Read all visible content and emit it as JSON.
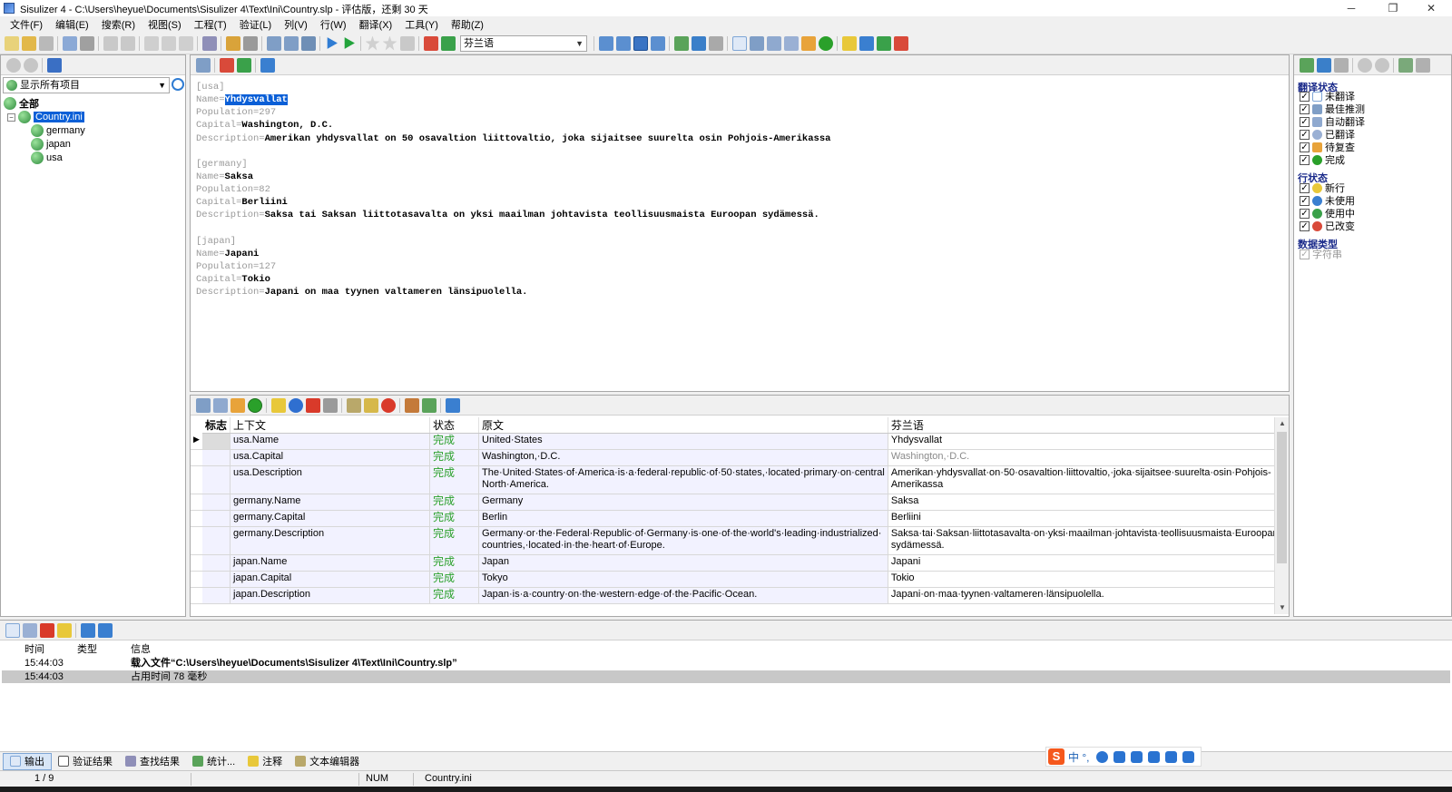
{
  "window": {
    "title": "Sisulizer 4 - C:\\Users\\heyue\\Documents\\Sisulizer 4\\Text\\Ini\\Country.slp - 评估版，还剩 30 天",
    "minimize": "─",
    "maximize": "❐",
    "close": "✕"
  },
  "menu": [
    "文件(F)",
    "编辑(E)",
    "搜索(R)",
    "视图(S)",
    "工程(T)",
    "验证(L)",
    "列(V)",
    "行(W)",
    "翻译(X)",
    "工具(Y)",
    "帮助(Z)"
  ],
  "toolbar": {
    "language_select": "芬兰语"
  },
  "left_panel": {
    "filter": "显示所有项目",
    "tree": {
      "root": "全部",
      "file": "Country.ini",
      "children": [
        "germany",
        "japan",
        "usa"
      ]
    }
  },
  "editor": {
    "sections": [
      {
        "header": "[usa]",
        "lines": [
          {
            "key": "Name=",
            "value": "Yhdysvallat",
            "highlight": true
          },
          {
            "key": "Population=297",
            "value": ""
          },
          {
            "key": "Capital=",
            "value": "Washington, D.C."
          },
          {
            "key": "Description=",
            "value": "Amerikan yhdysvallat on 50 osavaltion liittovaltio, joka sijaitsee suurelta osin Pohjois-Amerikassa"
          }
        ]
      },
      {
        "header": "[germany]",
        "lines": [
          {
            "key": "Name=",
            "value": "Saksa"
          },
          {
            "key": "Population=82",
            "value": ""
          },
          {
            "key": "Capital=",
            "value": "Berliini"
          },
          {
            "key": "Description=",
            "value": "Saksa tai Saksan liittotasavalta on yksi maailman johtavista teollisuusmaista Euroopan sydämessä."
          }
        ]
      },
      {
        "header": "[japan]",
        "lines": [
          {
            "key": "Name=",
            "value": "Japani"
          },
          {
            "key": "Population=127",
            "value": ""
          },
          {
            "key": "Capital=",
            "value": "Tokio"
          },
          {
            "key": "Description=",
            "value": "Japani on maa tyynen valtameren länsipuolella."
          }
        ]
      }
    ]
  },
  "grid": {
    "headers": {
      "flag": "标志",
      "context": "上下文",
      "status": "状态",
      "original": "原文",
      "translation": "芬兰语"
    },
    "rows": [
      {
        "context": "usa.Name",
        "status": "完成",
        "original": "United·States",
        "translation": "Yhdysvallat",
        "current": true
      },
      {
        "context": "usa.Capital",
        "status": "完成",
        "original": "Washington,·D.C.",
        "translation": "Washington,·D.C.",
        "grey": true
      },
      {
        "context": "usa.Description",
        "status": "完成",
        "original": "The·United·States·of·America·is·a·federal·republic·of·50·states,·located·primary·on·central North·America.",
        "translation": "Amerikan·yhdysvallat·on·50·osavaltion·liittovaltio,·joka·sijaitsee·suurelta·osin·Pohjois-Amerikassa"
      },
      {
        "context": "germany.Name",
        "status": "完成",
        "original": "Germany",
        "translation": "Saksa"
      },
      {
        "context": "germany.Capital",
        "status": "完成",
        "original": "Berlin",
        "translation": "Berliini"
      },
      {
        "context": "germany.Description",
        "status": "完成",
        "original": "Germany·or·the·Federal·Republic·of·Germany·is·one·of·the·world's·leading·industrialized· countries,·located·in·the·heart·of·Europe.",
        "translation": "Saksa·tai·Saksan·liittotasavalta·on·yksi·maailman·johtavista·teollisuusmaista·Euroopan· sydämessä."
      },
      {
        "context": "japan.Name",
        "status": "完成",
        "original": "Japan",
        "translation": "Japani"
      },
      {
        "context": "japan.Capital",
        "status": "完成",
        "original": "Tokyo",
        "translation": "Tokio"
      },
      {
        "context": "japan.Description",
        "status": "完成",
        "original": "Japan·is·a·country·on·the·western·edge·of·the·Pacific·Ocean.",
        "translation": "Japani·on·maa·tyynen·valtameren·länsipuolella."
      }
    ]
  },
  "right_panel": {
    "translation_status_title": "翻译状态",
    "translation_status": [
      "未翻译",
      "最佳推测",
      "自动翻译",
      "已翻译",
      "待复查",
      "完成"
    ],
    "row_status_title": "行状态",
    "row_status": [
      "新行",
      "未使用",
      "使用中",
      "已改变"
    ],
    "data_type_title": "数据类型",
    "data_types": [
      "字符串"
    ]
  },
  "output": {
    "headers": {
      "time": "时间",
      "type": "类型",
      "info": "信息"
    },
    "rows": [
      {
        "time": "15:44:03",
        "type": "",
        "info": "载入文件“C:\\Users\\heyue\\Documents\\Sisulizer 4\\Text\\Ini\\Country.slp”",
        "bold": true
      },
      {
        "time": "15:44:03",
        "type": "",
        "info": "占用时间 78 毫秒",
        "selected": true
      }
    ]
  },
  "bottom_tabs": [
    "输出",
    "验证结果",
    "查找结果",
    "统计...",
    "注释",
    "文本编辑器"
  ],
  "ime": {
    "logo": "S",
    "mode": "中 °,"
  },
  "status_bar": {
    "position": "1 / 9",
    "num": "NUM",
    "file": "Country.ini"
  },
  "colors": {
    "accent": "#0a5fd7",
    "status_done": "#2aa02a",
    "grid_row_bg": "#f2f2ff",
    "group_title": "#1a2a8a"
  }
}
